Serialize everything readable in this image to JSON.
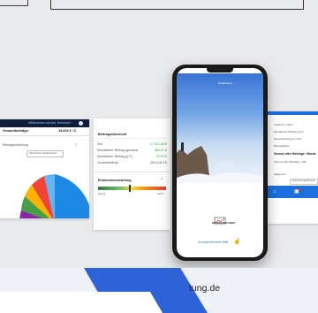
{
  "left_card": {
    "header": "Willkommen zurück, Benutzer!",
    "row_label": "Gesamtbeiträge:",
    "row_value": "18.654 € / €",
    "section": "Beitragsverteilung",
    "input_value": "Versicherungsübersicht",
    "pie_colors": [
      "#1e88e5",
      "#64b5f6",
      "#f44336",
      "#ffb300",
      "#43a047",
      "#8e24aa",
      "#fb8c00"
    ]
  },
  "mid_card": {
    "title": "Beitragsübersicht",
    "rows": [
      {
        "label": "Ziel",
        "value": "17.812,58 €"
      },
      {
        "label": "Monatlicher Beitrag (gesamt)",
        "value": "384,97 €"
      },
      {
        "label": "Monatlicher Beitrag (p.P.)",
        "value": "12,97 €"
      },
      {
        "label": "Gesamtbeitrag",
        "value": "263.218,4 €"
      }
    ],
    "rating_title": "Einkommensstufung",
    "rating_left": "gering",
    "rating_right": "hoch"
  },
  "right_card": {
    "rows": [
      "Laufzeit in Jahre",
      "Monatlicher Beitrag (p.P.)",
      "Gesamtbeitrag pro Jahr",
      "Beitragsjahre"
    ],
    "highlight": "Summe aller Beiträge / Monat",
    "sub": "Summe aller Beiträge / Jahr",
    "footer": "Diagramm",
    "input": "Versicherungsübersicht"
  },
  "phone": {
    "top_right": "Hauptmenü",
    "logo_text": "BEITRAGSRECHNER",
    "link": "Ich brauche keine Hilfe"
  },
  "footer": {
    "url_fragment": "tung.de"
  },
  "colors": {
    "accent": "#1d6fe0",
    "blue_band": "#2d62d8"
  }
}
